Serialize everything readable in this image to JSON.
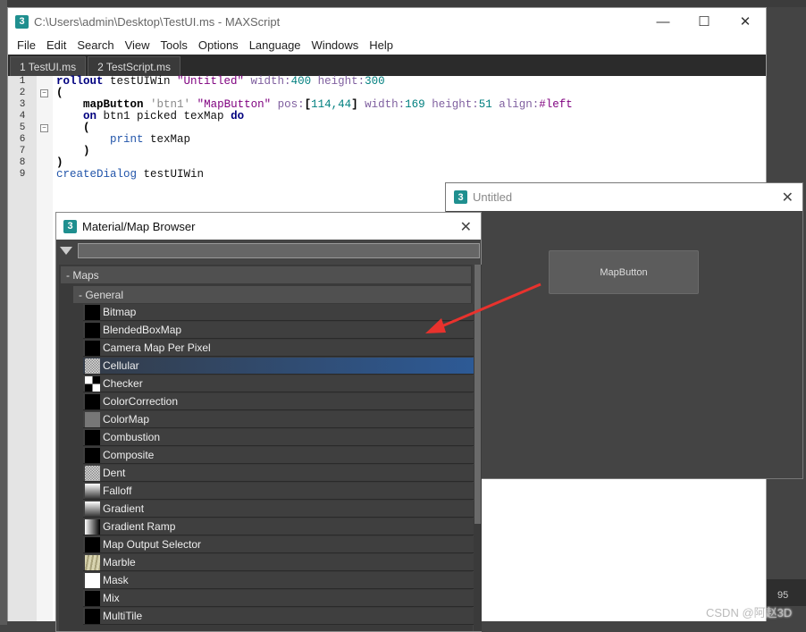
{
  "maxscript": {
    "title": "C:\\Users\\admin\\Desktop\\TestUI.ms - MAXScript",
    "logo": "3",
    "window_buttons": {
      "minimize": "—",
      "maximize": "☐",
      "close": "✕"
    },
    "menu": [
      "File",
      "Edit",
      "Search",
      "View",
      "Tools",
      "Options",
      "Language",
      "Windows",
      "Help"
    ],
    "tabs": [
      "1 TestUI.ms",
      "2 TestScript.ms"
    ],
    "line_numbers": [
      "1",
      "2",
      "3",
      "4",
      "5",
      "6",
      "7",
      "8",
      "9"
    ],
    "code": [
      [
        [
          "rollout",
          "kw"
        ],
        [
          " testUIWin ",
          "id"
        ],
        [
          "\"Untitled\"",
          "str"
        ],
        [
          " width:",
          "prm"
        ],
        [
          "400",
          "num"
        ],
        [
          " height:",
          "prm"
        ],
        [
          "300",
          "num"
        ]
      ],
      [
        [
          "(",
          "op"
        ]
      ],
      [
        [
          "    ",
          "id"
        ],
        [
          "mapButton",
          "bold"
        ],
        [
          " ",
          "id"
        ],
        [
          "'btn1'",
          "sq"
        ],
        [
          " ",
          "id"
        ],
        [
          "\"MapButton\"",
          "str"
        ],
        [
          " pos:",
          "prm"
        ],
        [
          "[",
          "op"
        ],
        [
          "114,44",
          "num"
        ],
        [
          "]",
          "op"
        ],
        [
          " width:",
          "prm"
        ],
        [
          "169",
          "num"
        ],
        [
          " height:",
          "prm"
        ],
        [
          "51",
          "num"
        ],
        [
          " align:",
          "prm"
        ],
        [
          "#left",
          "str"
        ]
      ],
      [
        [
          "    ",
          "id"
        ],
        [
          "on",
          "kw"
        ],
        [
          " btn1 picked texMap ",
          "id"
        ],
        [
          "do",
          "kw"
        ]
      ],
      [
        [
          "    ",
          "id"
        ],
        [
          "(",
          "op"
        ]
      ],
      [
        [
          "        ",
          "id"
        ],
        [
          "print",
          "fn"
        ],
        [
          " texMap",
          "id"
        ]
      ],
      [
        [
          "    ",
          "id"
        ],
        [
          ")",
          "op"
        ]
      ],
      [
        [
          ")",
          "op"
        ]
      ],
      [
        [
          "createDialog",
          "fn"
        ],
        [
          " testUIWin",
          "id"
        ]
      ]
    ]
  },
  "untitled": {
    "title": "Untitled",
    "logo": "3",
    "close": "✕",
    "button_label": "MapButton"
  },
  "browser": {
    "title": "Material/Map Browser",
    "logo": "3",
    "close": "✕",
    "search_value": "",
    "group": "- Maps",
    "subgroup": "- General",
    "selected": "Cellular",
    "items": [
      {
        "label": "Bitmap",
        "swatch": "black"
      },
      {
        "label": "BlendedBoxMap",
        "swatch": "black"
      },
      {
        "label": "Camera Map Per Pixel",
        "swatch": "black"
      },
      {
        "label": "Cellular",
        "swatch": "noise"
      },
      {
        "label": "Checker",
        "swatch": "checker"
      },
      {
        "label": "ColorCorrection",
        "swatch": "black"
      },
      {
        "label": "ColorMap",
        "swatch": "gray"
      },
      {
        "label": "Combustion",
        "swatch": "black"
      },
      {
        "label": "Composite",
        "swatch": "black"
      },
      {
        "label": "Dent",
        "swatch": "noise"
      },
      {
        "label": "Falloff",
        "swatch": "gradient-v"
      },
      {
        "label": "Gradient",
        "swatch": "gradient-v"
      },
      {
        "label": "Gradient Ramp",
        "swatch": "gradient-h"
      },
      {
        "label": "Map Output Selector",
        "swatch": "black"
      },
      {
        "label": "Marble",
        "swatch": "marble"
      },
      {
        "label": "Mask",
        "swatch": "white"
      },
      {
        "label": "Mix",
        "swatch": "black"
      },
      {
        "label": "MultiTile",
        "swatch": "black"
      }
    ]
  },
  "timeline": {
    "frame": "95"
  },
  "watermark": "CSDN @阿赵3D",
  "colors": {
    "accent": "#2d5a96",
    "arrow": "#e8322d",
    "logo": "#1f8f8f"
  }
}
